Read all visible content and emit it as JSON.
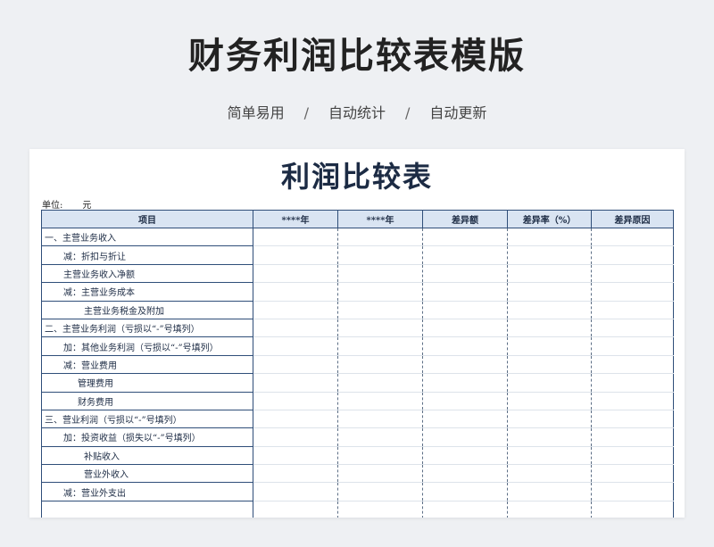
{
  "header": {
    "title": "财务利润比较表模版",
    "features": [
      "简单易用",
      "自动统计",
      "自动更新"
    ],
    "separator": "/"
  },
  "sheet": {
    "title": "利润比较表",
    "unit_label": "单位:",
    "unit_value": "元",
    "columns": [
      "项目",
      "****年",
      "****年",
      "差异额",
      "差异率（%）",
      "差异原因"
    ],
    "rows": [
      {
        "label": "一、主营业务收入",
        "level": 0
      },
      {
        "label": "减：折扣与折让",
        "level": 1
      },
      {
        "label": "主营业务收入净额",
        "level": 1
      },
      {
        "label": "减：主营业务成本",
        "level": 1
      },
      {
        "label": "主营业务税金及附加",
        "level": 3
      },
      {
        "label": "二、主营业务利润（亏损以“-”号填列）",
        "level": 0
      },
      {
        "label": "加：其他业务利润（亏损以“-”号填列）",
        "level": 1
      },
      {
        "label": "减：营业费用",
        "level": 1
      },
      {
        "label": "管理费用",
        "level": 2
      },
      {
        "label": "财务费用",
        "level": 2
      },
      {
        "label": "三、营业利润（亏损以“-”号填列）",
        "level": 0
      },
      {
        "label": "加：投资收益（损失以“-”号填列）",
        "level": 1
      },
      {
        "label": "补贴收入",
        "level": 3
      },
      {
        "label": "营业外收入",
        "level": 3
      },
      {
        "label": "减：营业外支出",
        "level": 1
      },
      {
        "label": "",
        "level": 0
      }
    ]
  }
}
